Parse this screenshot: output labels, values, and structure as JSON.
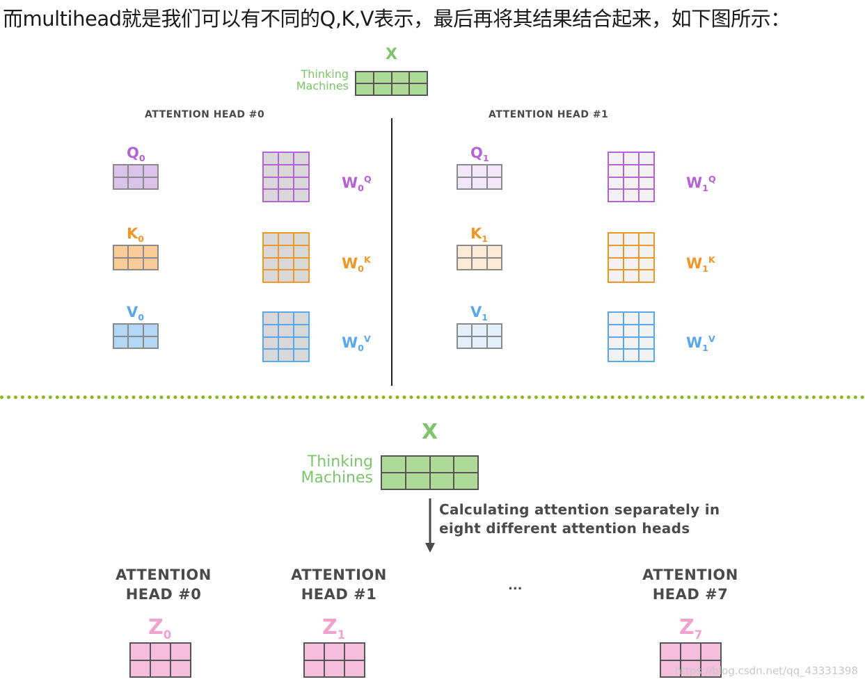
{
  "intro_text": "而multihead就是我们可以有不同的Q,K,V表示，最后再将其结果结合起来，如下图所示：",
  "top": {
    "x_label": "X",
    "input_words": [
      "Thinking",
      "Machines"
    ],
    "head0_title": "ATTENTION HEAD #0",
    "head1_title": "ATTENTION HEAD #1",
    "head0": {
      "q": {
        "base": "Q",
        "sub": "0"
      },
      "k": {
        "base": "K",
        "sub": "0"
      },
      "v": {
        "base": "V",
        "sub": "0"
      },
      "wq": {
        "base": "W",
        "sub": "0",
        "sup": "Q"
      },
      "wk": {
        "base": "W",
        "sub": "0",
        "sup": "K"
      },
      "wv": {
        "base": "W",
        "sub": "0",
        "sup": "V"
      }
    },
    "head1": {
      "q": {
        "base": "Q",
        "sub": "1"
      },
      "k": {
        "base": "K",
        "sub": "1"
      },
      "v": {
        "base": "V",
        "sub": "1"
      },
      "wq": {
        "base": "W",
        "sub": "1",
        "sup": "Q"
      },
      "wk": {
        "base": "W",
        "sub": "1",
        "sup": "K"
      },
      "wv": {
        "base": "W",
        "sub": "1",
        "sup": "V"
      }
    }
  },
  "bottom": {
    "x_label": "X",
    "input_words": [
      "Thinking",
      "Machines"
    ],
    "arrow_caption_line1": "Calculating attention separately in",
    "arrow_caption_line2": "eight different attention heads",
    "heads": [
      {
        "line1": "ATTENTION",
        "line2": "HEAD #0",
        "z": "Z",
        "sub": "0"
      },
      {
        "line1": "ATTENTION",
        "line2": "HEAD #1",
        "z": "Z",
        "sub": "1"
      },
      {
        "line1": "ATTENTION",
        "line2": "HEAD #7",
        "z": "Z",
        "sub": "7"
      }
    ],
    "ellipsis": "..."
  },
  "watermark": "https://blog.csdn.net/qq_43331398",
  "colors": {
    "green": "#7dc46a",
    "green_fill": "#aedb9a",
    "purple": "#b462d6",
    "purple_fill": "#dcc3ec",
    "purple_light_fill": "#f1e7f8",
    "orange": "#ef9628",
    "orange_fill": "#fbcc9a",
    "orange_light_fill": "#fdebd6",
    "blue": "#5aa7ee",
    "blue_fill": "#b5d7f6",
    "blue_light_fill": "#e3f0fb",
    "pink_fill": "#f6bedd",
    "gray_fill": "#d8d8d8",
    "gray_light_fill": "#f2f2f2",
    "divider": "#8ab61e"
  }
}
